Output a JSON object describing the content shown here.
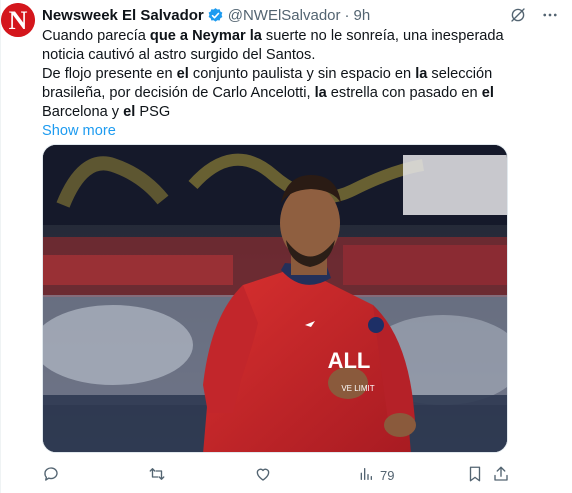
{
  "author": {
    "name": "Newsweek El Salvador",
    "handle": "@NWElSalvador",
    "separator": "·",
    "time": "9h",
    "avatar_letter": "N",
    "avatar_color": "#d4161c",
    "verified_color": "#1d9bf0"
  },
  "tweet": {
    "line1": {
      "t1": "Cuando parecía ",
      "b1": "que a Neymar la",
      "t2": " suerte no le sonreía, una inesperada noticia cautivó al astro surgido del Santos."
    },
    "line2": {
      "t1": "De flojo presente en ",
      "b1": "el",
      "t2": " conjunto paulista y sin espacio en ",
      "b2": "la",
      "t3": " selección brasileña, por decisión de Carlo Ancelotti, ",
      "b3": "la",
      "t4": " estrella con pasado en ",
      "b4": "el",
      "t5": " Barcelona y ",
      "b5": "el",
      "t6": " PSG"
    },
    "show_more": "Show more"
  },
  "media": {
    "jersey_text": "ALL",
    "jersey_sub": "VE LIMIT",
    "jersey_color": "#c8242a"
  },
  "actions": {
    "views_count": "79"
  },
  "icons": {
    "header": [
      "grok-icon",
      "more-icon"
    ],
    "footer": [
      "reply-icon",
      "retweet-icon",
      "like-icon",
      "views-icon",
      "bookmark-icon",
      "share-icon"
    ]
  },
  "colors": {
    "text": "#0f1419",
    "secondary": "#536471",
    "link": "#1d9bf0"
  }
}
